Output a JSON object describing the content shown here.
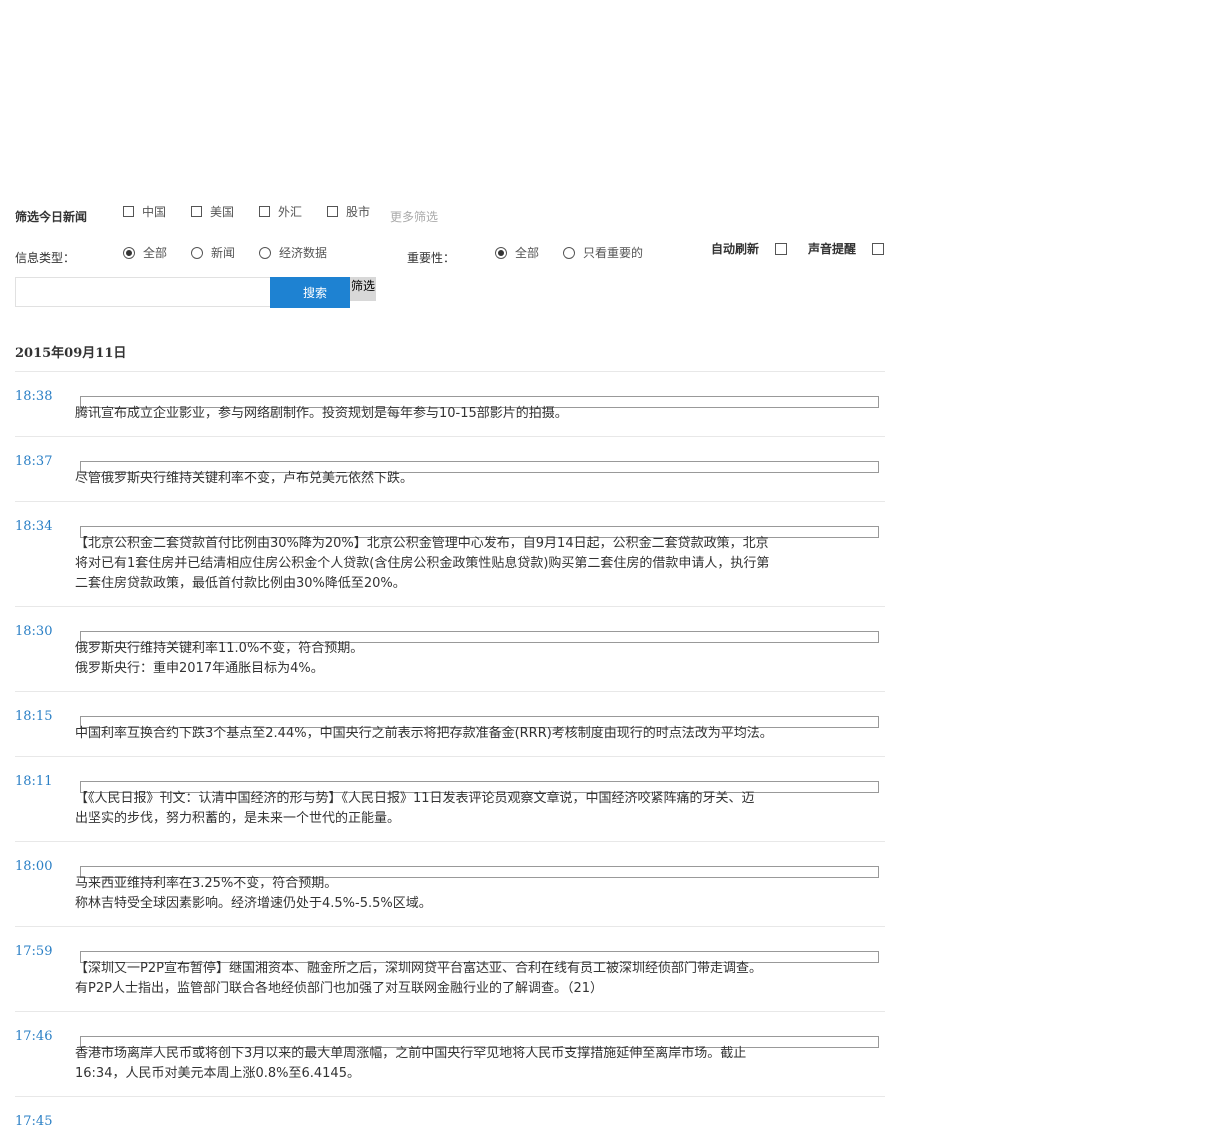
{
  "filters": {
    "today_label": "筛选今日新闻",
    "regions": [
      "中国",
      "美国",
      "外汇",
      "股市"
    ],
    "more_label": "更多筛选",
    "type_label": "信息类型：",
    "types": [
      "全部",
      "新闻",
      "经济数据"
    ],
    "type_selected": "全部",
    "importance_label": "重要性：",
    "importance": [
      "全部",
      "只看重要的"
    ],
    "importance_selected": "全部",
    "auto_refresh_label": "自动刷新",
    "sound_alert_label": "声音提醒",
    "search_placeholder": "",
    "search_button": "搜索",
    "filter_button": "筛选"
  },
  "date_heading": "2015年09月11日",
  "news": [
    {
      "time": "18:38",
      "text": "腾讯宣布成立企业影业，参与网络剧制作。投资规划是每年参与10-15部影片的拍摄。"
    },
    {
      "time": "18:37",
      "text": "尽管俄罗斯央行维持关键利率不变，卢布兑美元依然下跌。"
    },
    {
      "time": "18:34",
      "text": "【北京公积金二套贷款首付比例由30%降为20%】北京公积金管理中心发布，自9月14日起，公积金二套贷款政策，北京\n将对已有1套住房并已结清相应住房公积金个人贷款(含住房公积金政策性贴息贷款)购买第二套住房的借款申请人，执行第\n二套住房贷款政策，最低首付款比例由30%降低至20%。"
    },
    {
      "time": "18:30",
      "text": "俄罗斯央行维持关键利率11.0%不变，符合预期。\n俄罗斯央行：重申2017年通胀目标为4%。"
    },
    {
      "time": "18:15",
      "text": "中国利率互换合约下跌3个基点至2.44%，中国央行之前表示将把存款准备金(RRR)考核制度由现行的时点法改为平均法。"
    },
    {
      "time": "18:11",
      "text": "【《人民日报》刊文：认清中国经济的形与势】《人民日报》11日发表评论员观察文章说，中国经济咬紧阵痛的牙关、迈\n出坚实的步伐，努力积蓄的，是未来一个世代的正能量。"
    },
    {
      "time": "18:00",
      "text": "马来西亚维持利率在3.25%不变，符合预期。\n称林吉特受全球因素影响。经济增速仍处于4.5%-5.5%区域。"
    },
    {
      "time": "17:59",
      "text": "【深圳又一P2P宣布暂停】继国湘资本、融金所之后，深圳网贷平台富达亚、合利在线有员工被深圳经侦部门带走调查。\n有P2P人士指出，监管部门联合各地经侦部门也加强了对互联网金融行业的了解调查。（21）"
    },
    {
      "time": "17:46",
      "text": "香港市场离岸人民币或将创下3月以来的最大单周涨幅，之前中国央行罕见地将人民币支撑措施延伸至离岸市场。截止\n16:34，人民币对美元本周上涨0.8%至6.4145。"
    },
    {
      "time": "17:45",
      "text": ""
    }
  ]
}
